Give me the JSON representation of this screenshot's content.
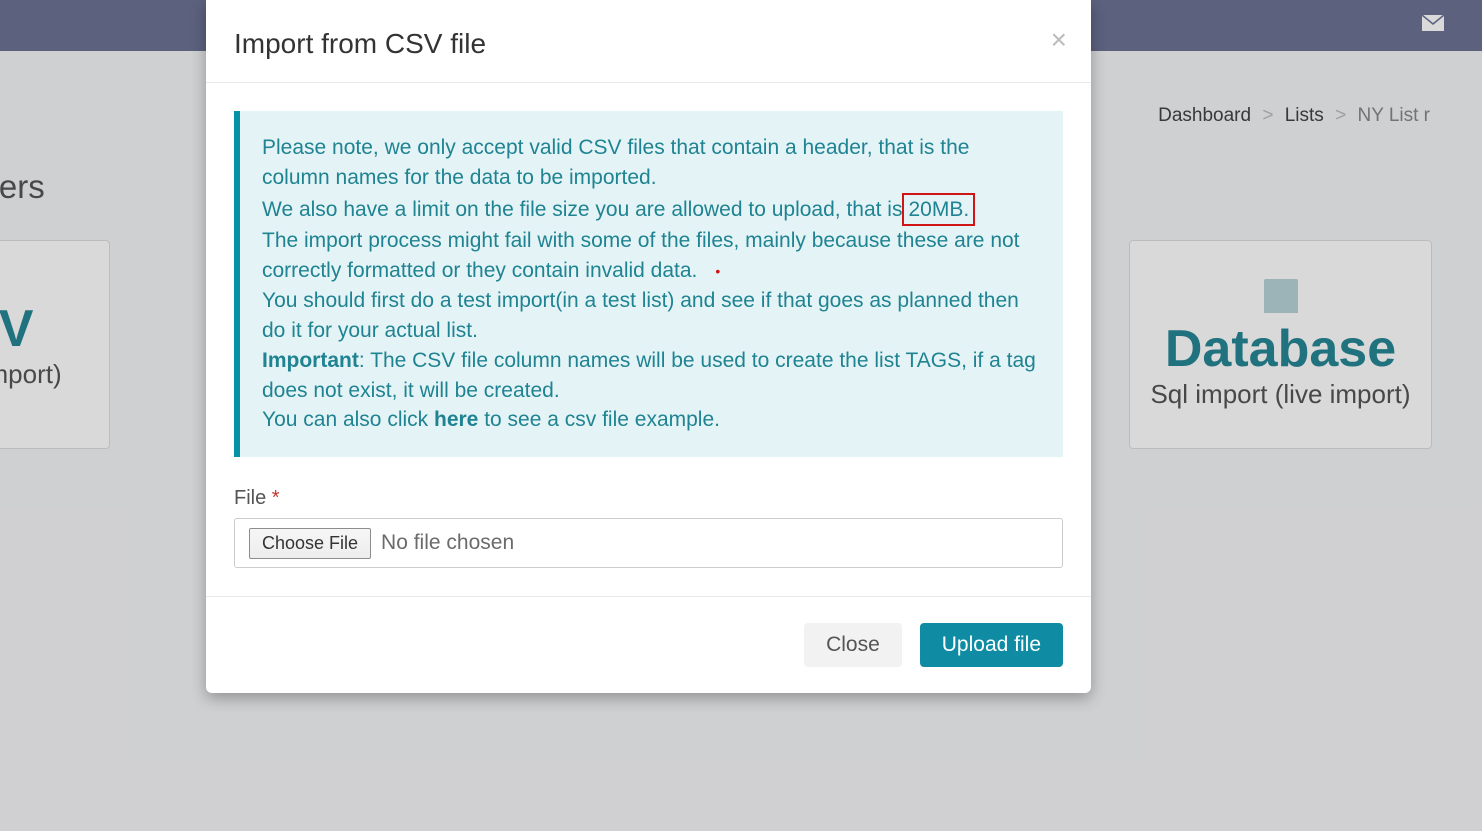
{
  "topbar": {
    "mail_icon": "mail-icon"
  },
  "breadcrumb": {
    "dashboard": "Dashboard",
    "lists": "Lists",
    "current": "NY List r"
  },
  "page": {
    "title_fragment": "port subscribers"
  },
  "cards": {
    "csv": {
      "title": "CSV",
      "sub": "le (live import)"
    },
    "db": {
      "title": "Database",
      "sub": "Sql import (live import)"
    }
  },
  "modal": {
    "title": "Import from CSV file",
    "close_glyph": "×",
    "callout": {
      "p1": "Please note, we only accept valid CSV files that contain a header, that is the column names for the data to be imported.",
      "p2a": "We also have a limit on the file size you are allowed to upload, that is",
      "size": " 20MB.",
      "p3": "The import process might fail with some of the files, mainly because these are not correctly formatted or they contain invalid data.",
      "p4": "You should first do a test import(in a test list) and see if that goes as planned then do it for your actual list.",
      "p5_strong": "Important",
      "p5_rest": ": The CSV file column names will be used to create the list TAGS, if a tag does not exist, it will be created.",
      "p6a": "You can also click ",
      "p6_link": "here",
      "p6b": " to see a csv file example."
    },
    "file": {
      "label": "File",
      "required": "*",
      "choose": "Choose File",
      "none": "No file chosen"
    },
    "footer": {
      "close": "Close",
      "upload": "Upload file"
    }
  }
}
